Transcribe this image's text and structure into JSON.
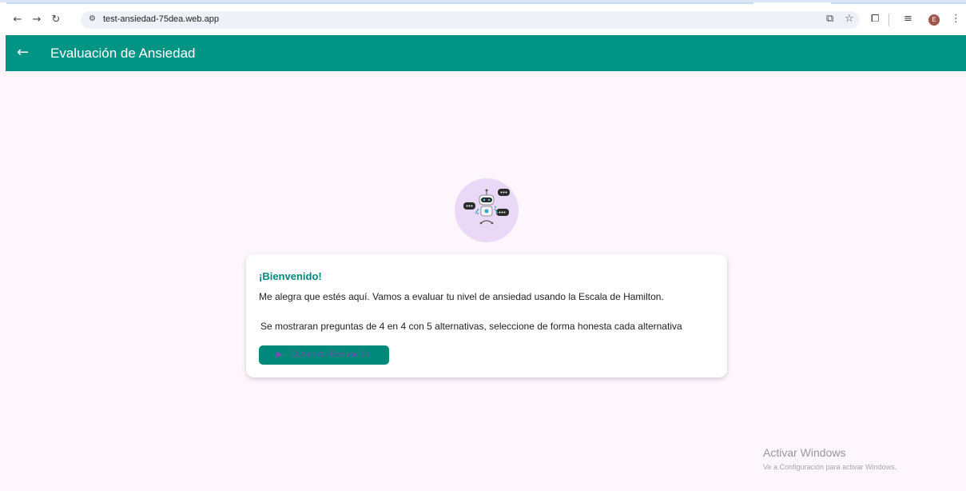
{
  "browser": {
    "url": "test-ansiedad-75dea.web.app",
    "avatar_letter": "E",
    "icons": [
      "back-icon",
      "forward-icon",
      "reload-icon",
      "site-info-icon",
      "install-app-icon",
      "bookmark-star-icon",
      "extensions-icon",
      "reading-list-icon",
      "menu-icon"
    ]
  },
  "appbar": {
    "title": "Evaluación de Ansiedad",
    "color": "#009484"
  },
  "card": {
    "title": "¡Bienvenido!",
    "text1": "Me alegra que estés aquí. Vamos a evaluar tu nivel de ansiedad usando la Escala de Hamilton.",
    "text2": "Se mostraran preguntas de 4 en 4 con 5 alternativas, seleccione de forma honesta cada alternativa",
    "button_label": "Comenzar Evaluación"
  },
  "watermark": {
    "title": "Activar Windows",
    "subtitle": "Ve a Configuración para activar Windows."
  },
  "colors": {
    "accent": "#00897b",
    "background": "#fdf6fd"
  }
}
